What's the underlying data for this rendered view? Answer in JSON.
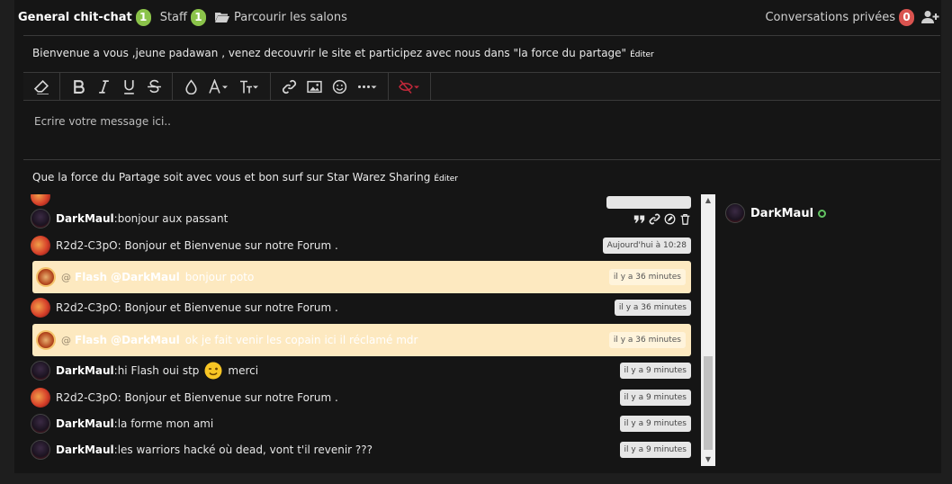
{
  "header": {
    "tabs": [
      {
        "label": "General chit-chat",
        "badge": "1"
      },
      {
        "label": "Staff",
        "badge": "1"
      },
      {
        "label": "Parcourir les salons"
      }
    ],
    "private": {
      "label": "Conversations privées",
      "badge": "0"
    }
  },
  "welcome": {
    "text": "Bienvenue a vous ,jeune padawan , venez decouvrir le site et participez avec nous dans \"la force du partage\"",
    "edit": "Éditer"
  },
  "editor": {
    "placeholder": "Ecrire votre message ici.."
  },
  "footer": {
    "text": "Que la force du Partage soit avec vous et bon surf sur Star Warez Sharing",
    "edit": "Éditer"
  },
  "messages": [
    {
      "author": "DarkMaul",
      "sep": ": ",
      "text": "bonjour aux passant"
    },
    {
      "author": "R2d2-C3pO",
      "text": ": Bonjour et Bienvenue sur notre Forum .",
      "time": "Aujourd'hui à 10:28"
    },
    {
      "at": "@",
      "author": "Flash",
      "target": "@DarkMaul",
      "text": "bonjour poto",
      "time": "il y a 36 minutes"
    },
    {
      "author": "R2d2-C3pO",
      "text": ": Bonjour et Bienvenue sur notre Forum .",
      "time": "il y a 36 minutes"
    },
    {
      "at": "@",
      "author": "Flash",
      "target": "@DarkMaul",
      "text": "ok je fait venir les copain ici il réclamé mdr",
      "time": "il y a 36 minutes"
    },
    {
      "author": "DarkMaul",
      "sep": ": ",
      "text": "hi Flash oui stp",
      "text2": "merci",
      "time": "il y a 9 minutes"
    },
    {
      "author": "R2d2-C3pO",
      "text": ": Bonjour et Bienvenue sur notre Forum .",
      "time": "il y a 9 minutes"
    },
    {
      "author": "DarkMaul",
      "sep": ": ",
      "text": "la forme mon ami",
      "time": "il y a 9 minutes"
    },
    {
      "author": "DarkMaul",
      "sep": ": ",
      "text": "les warriors hacké où dead, vont t'il revenir ???",
      "time": "il y a 9 minutes"
    }
  ],
  "online": [
    {
      "name": "DarkMaul"
    }
  ],
  "colors": {
    "badge_green": "#8bc34a",
    "badge_red": "#d9534f",
    "mention_bg": "#fde9c0",
    "online": "#62c462"
  }
}
